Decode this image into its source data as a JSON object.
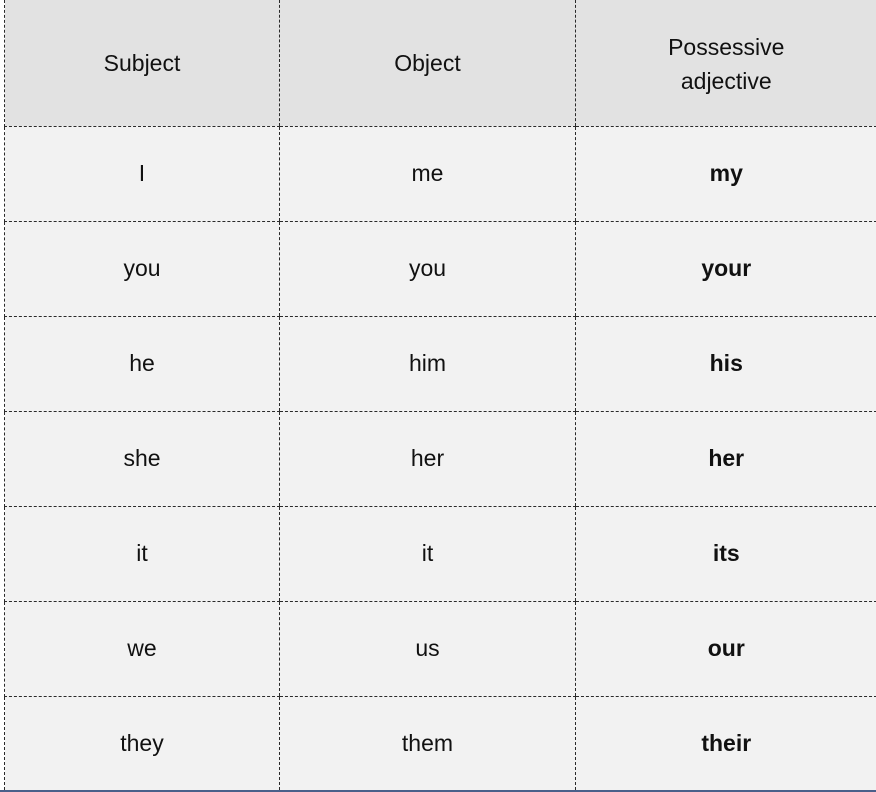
{
  "table": {
    "headers": {
      "subject": "Subject",
      "object": "Object",
      "possessive": "Possessive adjective"
    },
    "rows": [
      {
        "subject": "I",
        "object": "me",
        "possessive": "my"
      },
      {
        "subject": "you",
        "object": "you",
        "possessive": "your"
      },
      {
        "subject": "he",
        "object": "him",
        "possessive": "his"
      },
      {
        "subject": "she",
        "object": "her",
        "possessive": "her"
      },
      {
        "subject": "it",
        "object": "it",
        "possessive": "its"
      },
      {
        "subject": "we",
        "object": "us",
        "possessive": "our"
      },
      {
        "subject": "they",
        "object": "them",
        "possessive": "their"
      }
    ]
  },
  "colors": {
    "header_bg": "#e2e2e2",
    "cell_bg": "#f2f2f2",
    "border": "#2a2a2a",
    "bottom_rule": "#4a5f8a"
  }
}
